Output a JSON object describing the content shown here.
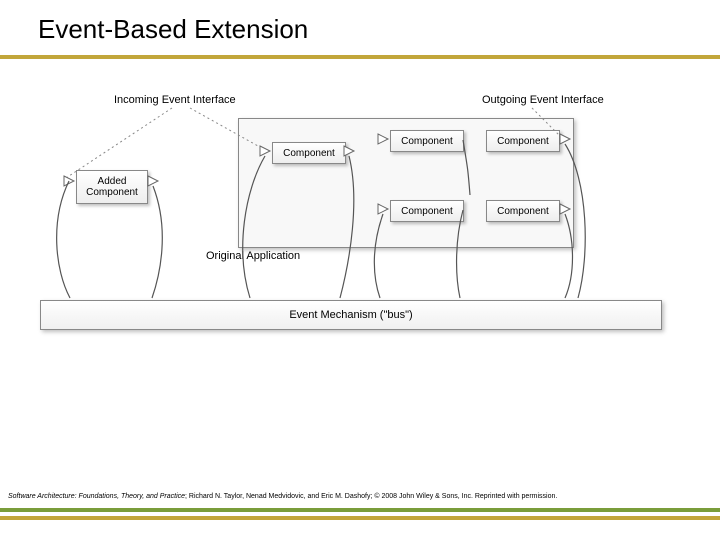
{
  "title": "Event-Based Extension",
  "labels": {
    "incoming": "Incoming Event Interface",
    "outgoing": "Outgoing Event Interface",
    "added": "Added\nComponent",
    "original": "Original Application",
    "bus": "Event Mechanism (\"bus\")",
    "component": "Component"
  },
  "footer": {
    "book": "Software Architecture: Foundations, Theory, and Practice",
    "rest": "; Richard N. Taylor, Nenad Medvidovic, and Eric M. Dashofy; © 2008 John Wiley & Sons, Inc. Reprinted with permission."
  }
}
